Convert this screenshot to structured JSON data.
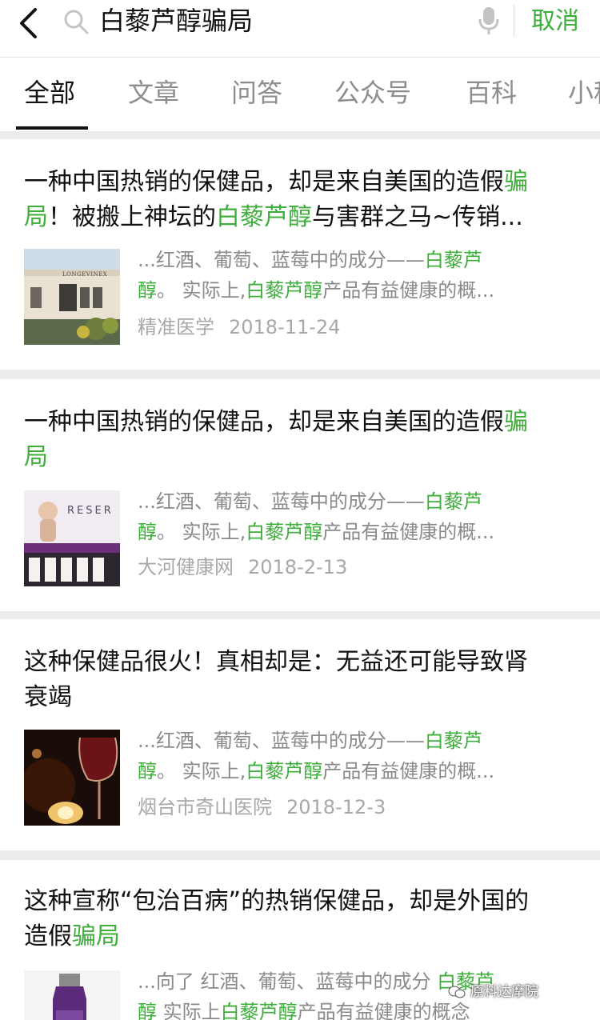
{
  "search": {
    "query": "白藜芦醇骗局",
    "cancel_label": "取消"
  },
  "tabs": [
    {
      "label": "全部",
      "active": true
    },
    {
      "label": "文章"
    },
    {
      "label": "问答"
    },
    {
      "label": "公众号"
    },
    {
      "label": "百科"
    },
    {
      "label": "小程"
    }
  ],
  "results": [
    {
      "title_lines": [
        [
          {
            "t": "一种中国热销的保健品，却是来自美国的造假"
          },
          {
            "t": "骗",
            "hl": true
          }
        ],
        [
          {
            "t": "局",
            "hl": true
          },
          {
            "t": "！被搬上神坛的"
          },
          {
            "t": "白藜芦醇",
            "hl": true
          },
          {
            "t": "与害群之马~传销..."
          }
        ]
      ],
      "snippet_lines": [
        [
          {
            "t": "...红酒、葡萄、蓝莓中的成分——"
          },
          {
            "t": "白藜芦",
            "hl": true
          }
        ],
        [
          {
            "t": "醇",
            "hl": true
          },
          {
            "t": "。 实际上,"
          },
          {
            "t": "白藜芦醇",
            "hl": true
          },
          {
            "t": "产品有益健康的概..."
          }
        ]
      ],
      "source": "精准医学",
      "date": "2018-11-24",
      "thumb_text": "LONGEVINEX"
    },
    {
      "title_lines": [
        [
          {
            "t": "一种中国热销的保健品，却是来自美国的造假"
          },
          {
            "t": "骗",
            "hl": true
          }
        ],
        [
          {
            "t": "局",
            "hl": true
          }
        ]
      ],
      "snippet_lines": [
        [
          {
            "t": "...红酒、葡萄、蓝莓中的成分——"
          },
          {
            "t": "白藜芦",
            "hl": true
          }
        ],
        [
          {
            "t": "醇",
            "hl": true
          },
          {
            "t": "。 实际上,"
          },
          {
            "t": "白藜芦醇",
            "hl": true
          },
          {
            "t": "产品有益健康的概..."
          }
        ]
      ],
      "source": "大河健康网",
      "date": "2018-2-13",
      "thumb_text": "RESER"
    },
    {
      "title_lines": [
        [
          {
            "t": "这种保健品很火！真相却是：无益还可能导致肾"
          }
        ],
        [
          {
            "t": "衰竭"
          }
        ]
      ],
      "snippet_lines": [
        [
          {
            "t": "...红酒、葡萄、蓝莓中的成分——"
          },
          {
            "t": "白藜芦",
            "hl": true
          }
        ],
        [
          {
            "t": "醇",
            "hl": true
          },
          {
            "t": "。 实际上,"
          },
          {
            "t": "白藜芦醇",
            "hl": true
          },
          {
            "t": "产品有益健康的概..."
          }
        ]
      ],
      "source": "烟台市奇山医院",
      "date": "2018-12-3"
    },
    {
      "title_lines": [
        [
          {
            "t": "这种宣称“包治百病”的热销保健品，却是外国的"
          }
        ],
        [
          {
            "t": "造假"
          },
          {
            "t": "骗局",
            "hl": true
          }
        ]
      ],
      "snippet_lines": [
        [
          {
            "t": "...向了 红酒、葡萄、蓝莓中的成分 "
          },
          {
            "t": "白藜芦",
            "hl": true
          }
        ],
        [
          {
            "t": "醇",
            "hl": true
          },
          {
            "t": " 实际上"
          },
          {
            "t": "白藜芦醇",
            "hl": true
          },
          {
            "t": "产品有益健康的概念"
          }
        ]
      ]
    }
  ],
  "watermark": "原料达摩院",
  "colors": {
    "accent": "#3dae3a",
    "meta": "#a8a8a8",
    "snippet": "#8a8a8a"
  },
  "icons": [
    "back-arrow-icon",
    "search-icon",
    "microphone-icon"
  ]
}
